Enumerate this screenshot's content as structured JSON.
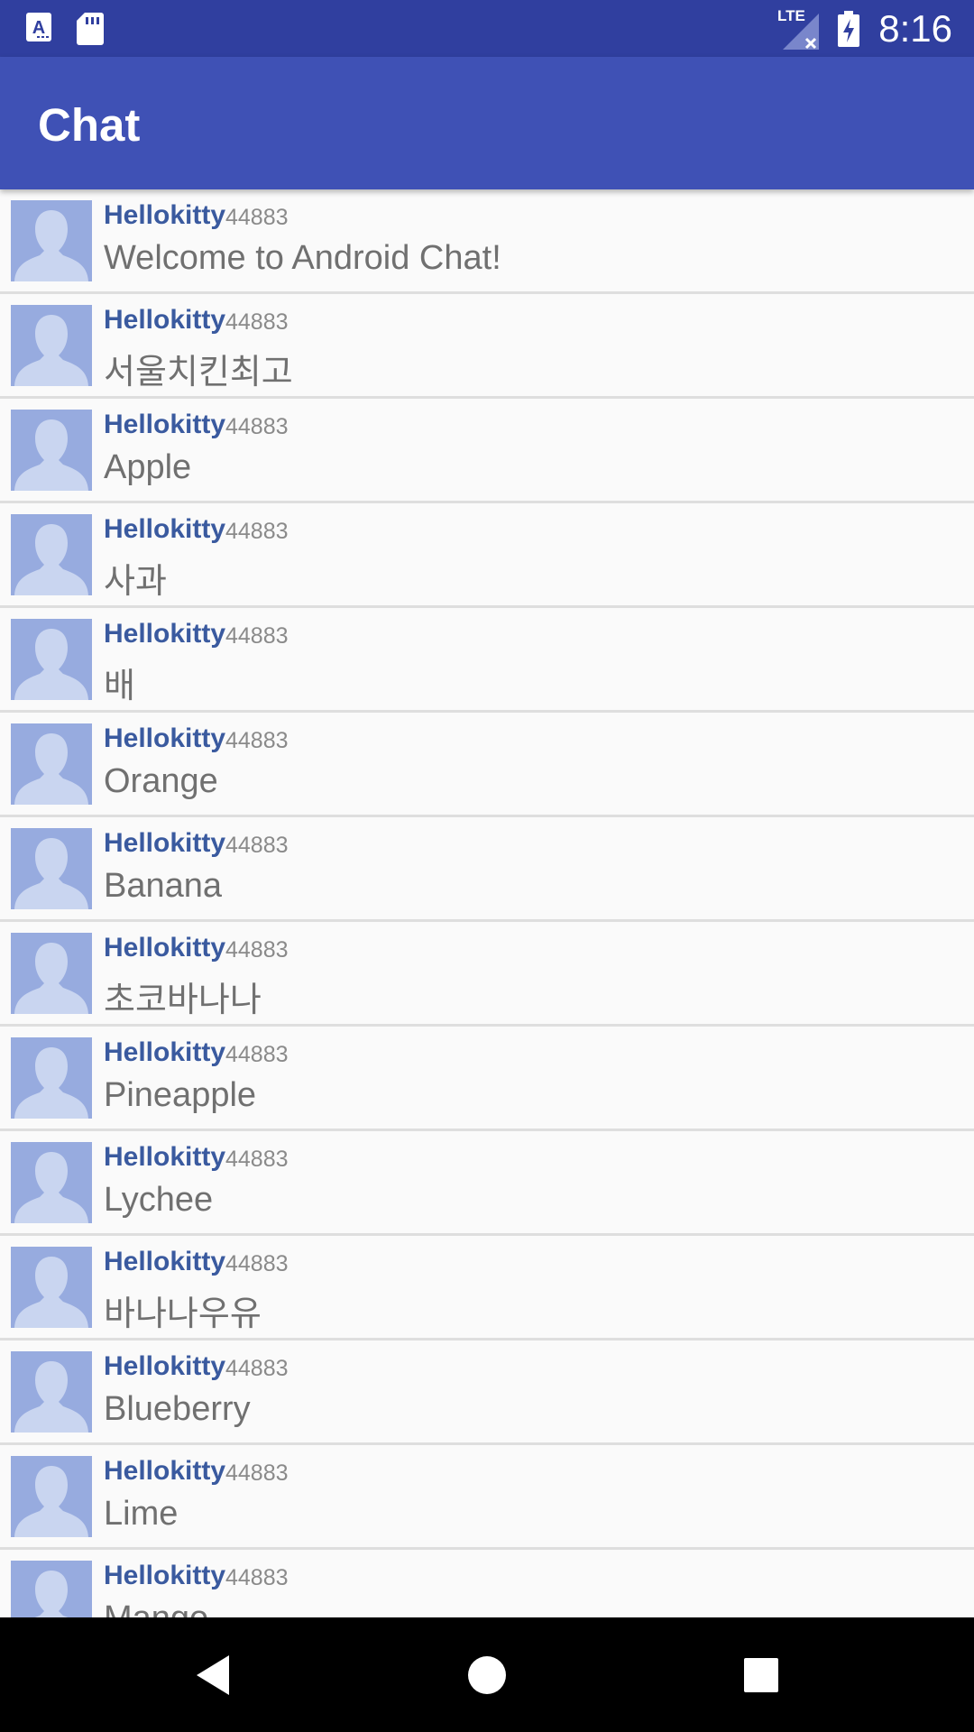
{
  "status_bar": {
    "time": "8:16",
    "network": "LTE",
    "icons": [
      "a-notification-icon",
      "sd-card-icon",
      "signal-icon",
      "battery-charging-icon"
    ]
  },
  "app_bar": {
    "title": "Chat"
  },
  "colors": {
    "status_bar": "#303f9f",
    "app_bar": "#3f51b5",
    "username": "#3a5a9f",
    "avatar_bg": "#97abdf",
    "message": "#707070"
  },
  "messages": [
    {
      "user": "Hellokitty",
      "id": "44883",
      "text": "Welcome to Android Chat!"
    },
    {
      "user": "Hellokitty",
      "id": "44883",
      "text": "서울치킨최고"
    },
    {
      "user": "Hellokitty",
      "id": "44883",
      "text": "Apple"
    },
    {
      "user": "Hellokitty",
      "id": "44883",
      "text": "사과"
    },
    {
      "user": "Hellokitty",
      "id": "44883",
      "text": "배"
    },
    {
      "user": "Hellokitty",
      "id": "44883",
      "text": "Orange"
    },
    {
      "user": "Hellokitty",
      "id": "44883",
      "text": "Banana"
    },
    {
      "user": "Hellokitty",
      "id": "44883",
      "text": "초코바나나"
    },
    {
      "user": "Hellokitty",
      "id": "44883",
      "text": "Pineapple"
    },
    {
      "user": "Hellokitty",
      "id": "44883",
      "text": "Lychee"
    },
    {
      "user": "Hellokitty",
      "id": "44883",
      "text": "바나나우유"
    },
    {
      "user": "Hellokitty",
      "id": "44883",
      "text": "Blueberry"
    },
    {
      "user": "Hellokitty",
      "id": "44883",
      "text": "Lime"
    },
    {
      "user": "Hellokitty",
      "id": "44883",
      "text": "Mango"
    }
  ],
  "nav_bar": {
    "buttons": [
      "back-icon",
      "home-icon",
      "recents-icon"
    ]
  }
}
